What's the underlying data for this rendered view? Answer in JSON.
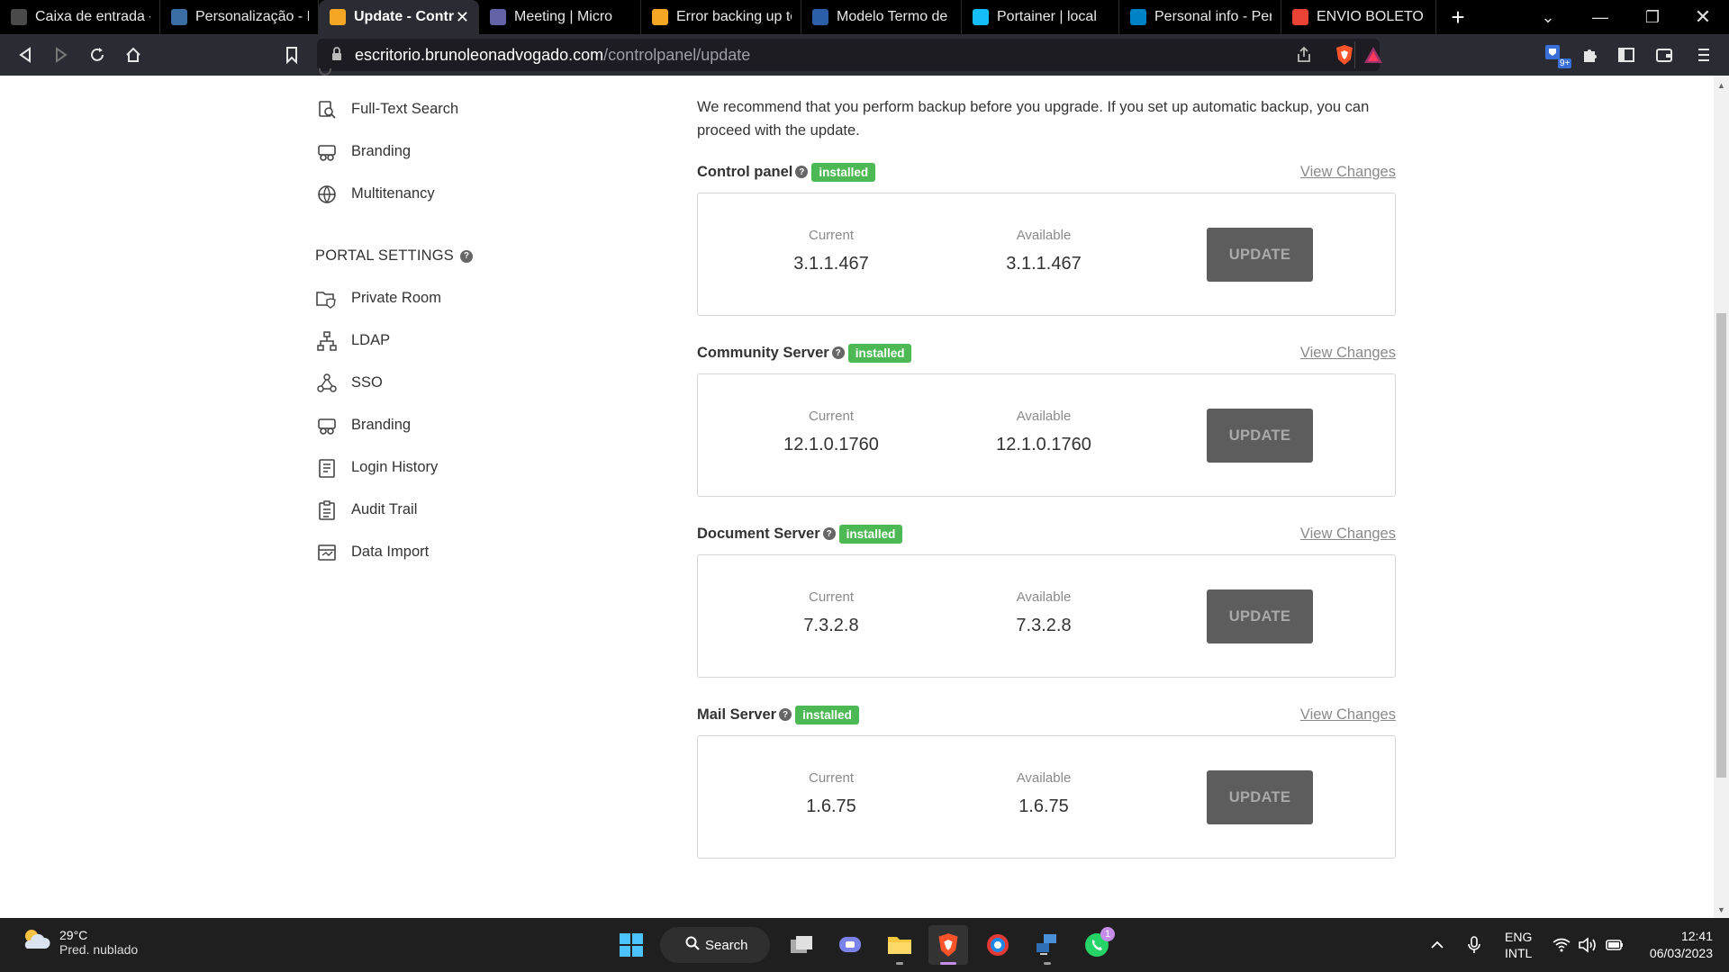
{
  "browser": {
    "tabs": [
      {
        "title": "Caixa de entrada - E",
        "icon": "mail-icon",
        "color": "#4a4a4a"
      },
      {
        "title": "Personalização - Bru",
        "icon": "document-icon",
        "color": "#3a6ea5"
      },
      {
        "title": "Update - Contr",
        "icon": "onlyoffice-icon",
        "color": "#f5a623",
        "active": true
      },
      {
        "title": "Meeting | Micro",
        "icon": "teams-icon",
        "color": "#6264a7"
      },
      {
        "title": "Error backing up to",
        "icon": "onlyoffice-icon",
        "color": "#f5a623"
      },
      {
        "title": "Modelo Termo de c",
        "icon": "m-icon",
        "color": "#2d5fa8"
      },
      {
        "title": "Portainer | local",
        "icon": "portainer-icon",
        "color": "#13bef9"
      },
      {
        "title": "Personal info - Pers",
        "icon": "nextcloud-icon",
        "color": "#0082c9"
      },
      {
        "title": "ENVIO BOLETO TAX",
        "icon": "gmail-icon",
        "color": "#ea4335"
      }
    ],
    "url_host": "escritorio.brunoleonadvogado.com",
    "url_path": "/controlpanel/update",
    "extension_badge": "9+"
  },
  "sidebar": {
    "items_top": [
      {
        "label": "Full-Text Search",
        "icon": "fulltext-search-icon"
      },
      {
        "label": "Branding",
        "icon": "branding-icon"
      },
      {
        "label": "Multitenancy",
        "icon": "multitenancy-icon"
      }
    ],
    "portal_settings_title": "PORTAL SETTINGS",
    "items_portal": [
      {
        "label": "Private Room",
        "icon": "private-room-icon"
      },
      {
        "label": "LDAP",
        "icon": "ldap-icon"
      },
      {
        "label": "SSO",
        "icon": "sso-icon"
      },
      {
        "label": "Branding",
        "icon": "branding-icon"
      },
      {
        "label": "Login History",
        "icon": "login-history-icon"
      },
      {
        "label": "Audit Trail",
        "icon": "audit-trail-icon"
      },
      {
        "label": "Data Import",
        "icon": "data-import-icon"
      }
    ]
  },
  "main": {
    "intro": "We recommend that you perform backup before you upgrade. If you set up automatic backup, you can proceed with the update.",
    "current_label": "Current",
    "available_label": "Available",
    "update_label": "UPDATE",
    "view_changes_label": "View Changes",
    "installed_label": "installed",
    "products": [
      {
        "name": "Control panel",
        "current": "3.1.1.467",
        "available": "3.1.1.467"
      },
      {
        "name": "Community Server",
        "current": "12.1.0.1760",
        "available": "12.1.0.1760"
      },
      {
        "name": "Document Server",
        "current": "7.3.2.8",
        "available": "7.3.2.8"
      },
      {
        "name": "Mail Server",
        "current": "1.6.75",
        "available": "1.6.75"
      }
    ]
  },
  "taskbar": {
    "temperature": "29°C",
    "condition": "Pred. nublado",
    "search_label": "Search",
    "whatsapp_badge": "1",
    "lang_top": "ENG",
    "lang_bottom": "INTL",
    "time": "12:41",
    "date": "06/03/2023"
  }
}
